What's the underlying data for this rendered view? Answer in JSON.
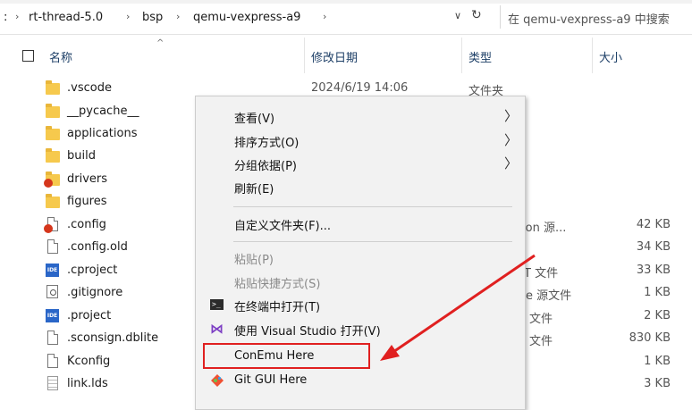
{
  "address_bar": {
    "crumbs": [
      ":",
      "rt-thread-5.0",
      "bsp",
      "qemu-vexpress-a9"
    ],
    "search_placeholder": "在 qemu-vexpress-a9 中搜索"
  },
  "columns": {
    "name": "名称",
    "date": "修改日期",
    "type": "类型",
    "size": "大小"
  },
  "files": [
    {
      "name": ".vscode",
      "icon": "folder-icon",
      "date": "2024/6/19 14:06",
      "type": "文件夹",
      "size": ""
    },
    {
      "name": "__pycache__",
      "icon": "folder-icon",
      "date": "",
      "type": "",
      "size": ""
    },
    {
      "name": "applications",
      "icon": "folder-icon",
      "date": "",
      "type": "",
      "size": ""
    },
    {
      "name": "build",
      "icon": "folder-icon",
      "date": "",
      "type": "",
      "size": ""
    },
    {
      "name": "drivers",
      "icon": "folder-badge-icon",
      "date": "",
      "type": "",
      "size": ""
    },
    {
      "name": "figures",
      "icon": "folder-icon",
      "date": "",
      "type": "",
      "size": ""
    },
    {
      "name": ".config",
      "icon": "doc-badge-icon",
      "date": "",
      "type": "ation 源...",
      "size": "42 KB"
    },
    {
      "name": ".config.old",
      "icon": "doc-icon",
      "date": "",
      "type": "",
      "size": "34 KB"
    },
    {
      "name": ".cproject",
      "icon": "ide-icon",
      "date": "",
      "type": "T 文件",
      "size": "33 KB"
    },
    {
      "name": ".gitignore",
      "icon": "gear-doc-icon",
      "date": "",
      "type": "e 源文件",
      "size": "1 KB"
    },
    {
      "name": ".project",
      "icon": "ide-icon",
      "date": "",
      "type": "文件",
      "size": "2 KB"
    },
    {
      "name": ".sconsign.dblite",
      "icon": "doc-icon",
      "date": "",
      "type": "文件",
      "size": "830 KB"
    },
    {
      "name": "Kconfig",
      "icon": "doc-icon",
      "date": "",
      "type": "",
      "size": "1 KB"
    },
    {
      "name": "link.lds",
      "icon": "lines-doc-icon",
      "date": "",
      "type": "",
      "size": "3 KB"
    }
  ],
  "context_menu": {
    "items": [
      {
        "label": "查看(V)",
        "submenu": true,
        "disabled": false
      },
      {
        "label": "排序方式(O)",
        "submenu": true,
        "disabled": false
      },
      {
        "label": "分组依据(P)",
        "submenu": true,
        "disabled": false
      },
      {
        "label": "刷新(E)",
        "submenu": false,
        "disabled": false
      },
      {
        "label": "自定义文件夹(F)...",
        "submenu": false,
        "disabled": false
      },
      {
        "label": "粘贴(P)",
        "submenu": false,
        "disabled": true
      },
      {
        "label": "粘贴快捷方式(S)",
        "submenu": false,
        "disabled": true
      },
      {
        "label": "在终端中打开(T)",
        "submenu": false,
        "disabled": false,
        "icon": "terminal-icon"
      },
      {
        "label": "使用 Visual Studio 打开(V)",
        "submenu": false,
        "disabled": false,
        "icon": "visual-studio-icon"
      },
      {
        "label": "ConEmu Here",
        "submenu": false,
        "disabled": false,
        "highlighted": true
      },
      {
        "label": "Git GUI Here",
        "submenu": false,
        "disabled": false,
        "icon": "git-gui-icon"
      }
    ]
  },
  "colors": {
    "highlight_box": "#e02020",
    "annotation_arrow": "#e02020",
    "menu_bg": "#f2f2f2"
  }
}
